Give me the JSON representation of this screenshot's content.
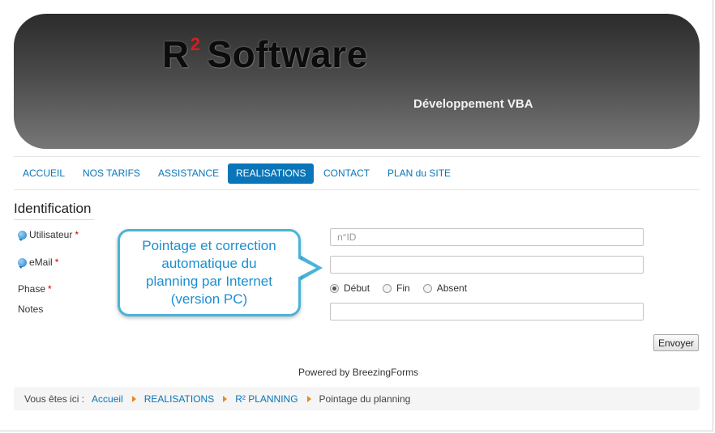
{
  "header": {
    "logo_main": "R",
    "logo_sup": "2",
    "logo_rest": "Software",
    "tagline": "Développement VBA"
  },
  "nav": {
    "items": [
      {
        "label": "ACCUEIL",
        "active": false
      },
      {
        "label": "NOS TARIFS",
        "active": false
      },
      {
        "label": "ASSISTANCE",
        "active": false
      },
      {
        "label": "REALISATIONS",
        "active": true
      },
      {
        "label": "CONTACT",
        "active": false
      },
      {
        "label": "PLAN du SITE",
        "active": false
      }
    ]
  },
  "form": {
    "title": "Identification",
    "user_label": "Utilisateur",
    "user_placeholder": "n°ID",
    "user_value": "",
    "email_label": "eMail",
    "email_value": "",
    "phase_label": "Phase",
    "phase_options": [
      "Début",
      "Fin",
      "Absent"
    ],
    "phase_selected": "Début",
    "notes_label": "Notes",
    "notes_value": "",
    "required_mark": "*",
    "submit_label": "Envoyer"
  },
  "callout": {
    "text_line1": "Pointage et correction",
    "text_line2": "automatique du",
    "text_line3": "planning par Internet",
    "text_line4": "(version PC)"
  },
  "footer": {
    "powered_by": "Powered by BreezingForms"
  },
  "breadcrumb": {
    "prefix": "Vous êtes ici :",
    "links": [
      "Accueil",
      "REALISATIONS",
      "R² PLANNING"
    ],
    "current": "Pointage du planning"
  },
  "colors": {
    "accent": "#0a75b8",
    "callout_border": "#4ab3d8",
    "callout_text": "#1b8fd0",
    "required": "#cc0000",
    "breadcrumb_separator": "#e8891c"
  }
}
